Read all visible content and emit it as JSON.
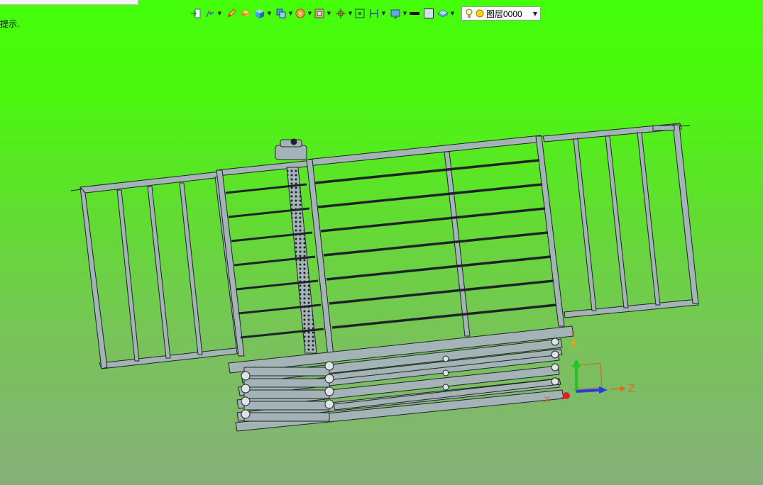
{
  "status": {
    "hint": "提示."
  },
  "toolbar": {
    "groups": [
      [
        "import-icon",
        "sketch-icon"
      ],
      [
        "pencil-icon",
        "extrude-icon",
        "solid-cube-icon"
      ],
      [
        "assembly-icon",
        "render-sphere-icon",
        "view-box-icon"
      ],
      [
        "snap-icon",
        "fit-view-icon",
        "dimension-icon"
      ],
      [
        "display-icon",
        "line-style-icon",
        "fill-color-icon",
        "layer-manager-icon"
      ]
    ]
  },
  "layer": {
    "current": "图层0000"
  },
  "axes": {
    "x": "X",
    "y": "Y",
    "z": "Z"
  },
  "colors": {
    "background_top": "#44ff0a",
    "background_bottom": "#86b079",
    "model_fill": "#a4b3b6",
    "model_edge": "#1e2426",
    "axis_y": "#1ec81e",
    "axis_z": "#2a3ae0",
    "axis_x": "#e02020",
    "axis_label": "#e06a1a"
  }
}
